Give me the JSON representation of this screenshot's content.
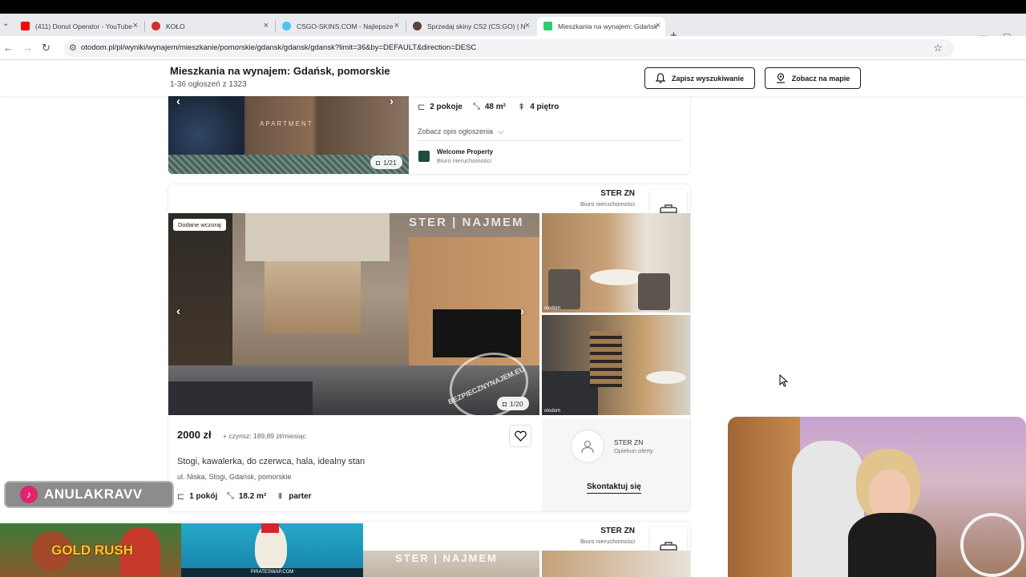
{
  "browser": {
    "tabs": [
      {
        "title": "(411) Donut Operator - YouTube",
        "favicon_color": "#ff0000"
      },
      {
        "title": "KOŁO",
        "favicon_color": "#d32f2f"
      },
      {
        "title": "CSGO-SKINS.COM - Najlepsze",
        "favicon_color": "#4fc3f7"
      },
      {
        "title": "Sprzedaj skiny CS2 (CS:GO) | N",
        "favicon_color": "#5d4037"
      },
      {
        "title": "Mieszkania na wynajem: Gdańsk",
        "favicon_color": "#2ecc71"
      }
    ],
    "url": "otodom.pl/pl/wyniki/wynajem/mieszkanie/pomorskie/gdansk/gdansk/gdansk?limit=36&by=DEFAULT&direction=DESC"
  },
  "header": {
    "title": "Mieszkania na wynajem: Gdańsk, pomorskie",
    "subtitle": "1-36 ogłoszeń z 1323",
    "save_search": "Zapisz wyszukiwanie",
    "see_map": "Zobacz na mapie"
  },
  "listing_prev": {
    "rooms": "2 pokoje",
    "area": "48 m²",
    "floor": "4 piętro",
    "show_description": "Zobacz opis ogłoszenia",
    "agency_name": "Welcome Property",
    "agency_type": "Biuro nieruchomości",
    "photo_counter": "1/21",
    "watermark": "APARTMENT"
  },
  "listing_main": {
    "agency_name": "STER ZN",
    "agency_type": "Biuro nieruchomości",
    "badge": "Dodane wczoraj",
    "photo_counter": "1/20",
    "watermark_brand": "STER | NAJMEM",
    "stamp_text": "BEZPIECZNYNAJEM.EU",
    "thumb_logo": "otodom",
    "price": "2000 zł",
    "rent_extra": "+ czynsz: 189,89 zł/miesiąc",
    "title": "Stogi, kawalerka, do czerwca, hala, idealny stan",
    "address": "ul. Niska, Stogi, Gdańsk, pomorskie",
    "rooms": "1 pokój",
    "area": "18.2 m²",
    "floor": "parter",
    "contact_name": "STER ZN",
    "contact_role": "Opiekun oferty",
    "contact_button": "Skontaktuj się"
  },
  "listing_next": {
    "agency_name": "STER ZN",
    "agency_type": "Biuro nieruchomości",
    "watermark_brand": "STER | NAJMEM"
  },
  "overlays": {
    "tiktok_handle": "ANULAKRAVV",
    "game_banner": "GOLD RUSH",
    "ad_site": "PIRATESWAP.COM"
  },
  "colors": {
    "accent_dark": "#1a1a1a",
    "agency_logo": "#1f4d3a",
    "tiktok_pink": "#e0246d"
  }
}
